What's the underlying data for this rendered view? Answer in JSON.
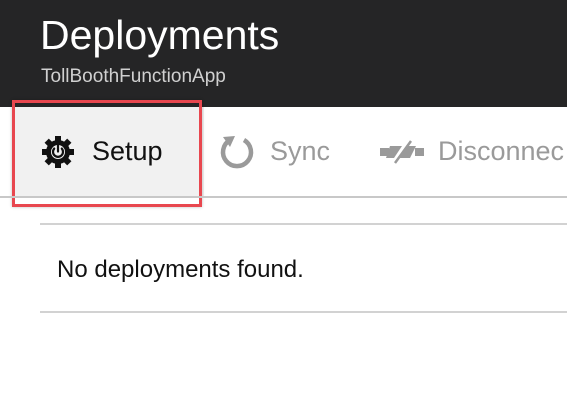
{
  "blade": {
    "title": "Deployments",
    "subtitle": "TollBoothFunctionApp"
  },
  "toolbar": {
    "setup_label": "Setup",
    "sync_label": "Sync",
    "disconnect_label": "Disconnec",
    "setup_icon": "gear-power-icon",
    "sync_icon": "sync-icon",
    "disconnect_icon": "disconnect-icon"
  },
  "list": {
    "empty_message": "No deployments found."
  },
  "colors": {
    "header_bg": "#252526",
    "highlight": "#e8474f",
    "disabled_text": "#9a9a9a"
  }
}
